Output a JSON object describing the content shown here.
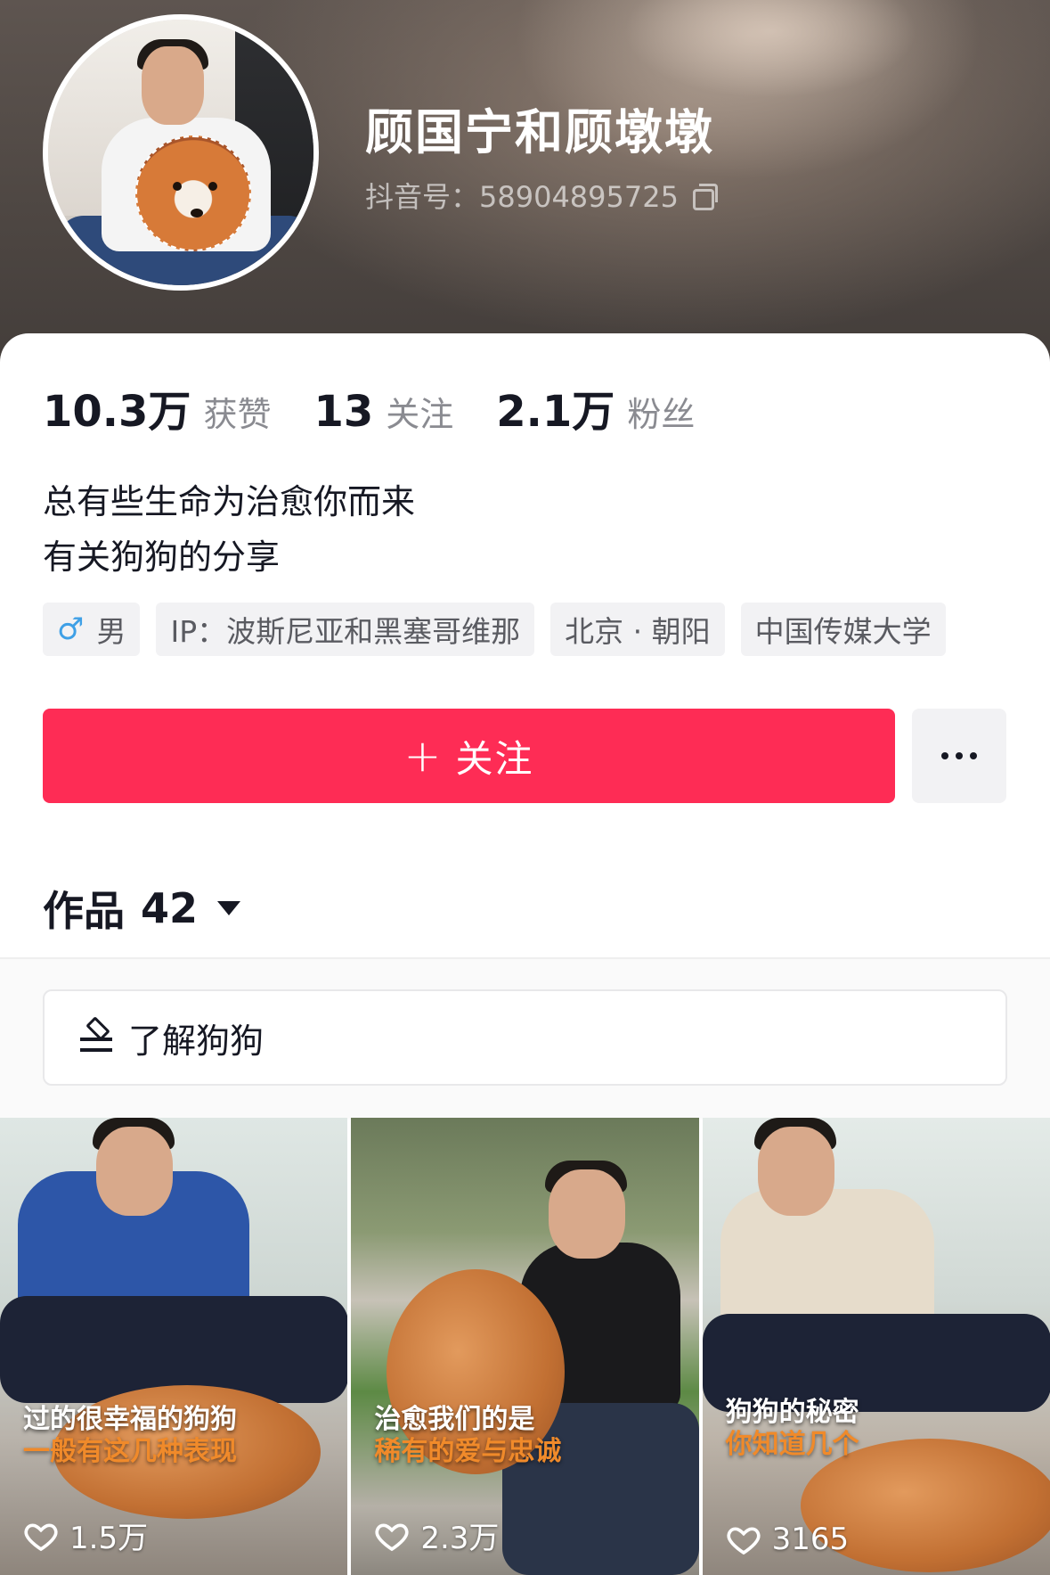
{
  "profile": {
    "name": "顾国宁和顾墩墩",
    "douyin_id": "抖音号：58904895725"
  },
  "stats": [
    {
      "value": "10.3万",
      "label": "获赞"
    },
    {
      "value": "13",
      "label": "关注"
    },
    {
      "value": "2.1万",
      "label": "粉丝"
    }
  ],
  "bio": {
    "line1": "总有些生命为治愈你而来",
    "line2": "有关狗狗的分享"
  },
  "tags": {
    "gender_icon": "♂",
    "gender": "男",
    "ip": "IP：波斯尼亚和黑塞哥维那",
    "location": "北京 · 朝阳",
    "school": "中国传媒大学"
  },
  "actions": {
    "follow_plus": "+",
    "follow_label": "关注"
  },
  "works_tab": {
    "label": "作品",
    "count": "42"
  },
  "collection": {
    "label": "了解狗狗"
  },
  "videos": [
    {
      "caption1": "过的很幸福的狗狗",
      "caption2": "一般有这几种表现",
      "likes": "1.5万"
    },
    {
      "caption1": "治愈我们的是",
      "caption2": "稀有的爱与忠诚",
      "likes": "2.3万"
    },
    {
      "caption1": "狗狗的秘密",
      "caption2": "你知道几个",
      "likes": "3165"
    }
  ],
  "colors": {
    "accent": "#fe2c55",
    "caption_orange": "#f08a2a",
    "male_blue": "#3fa0e6"
  }
}
